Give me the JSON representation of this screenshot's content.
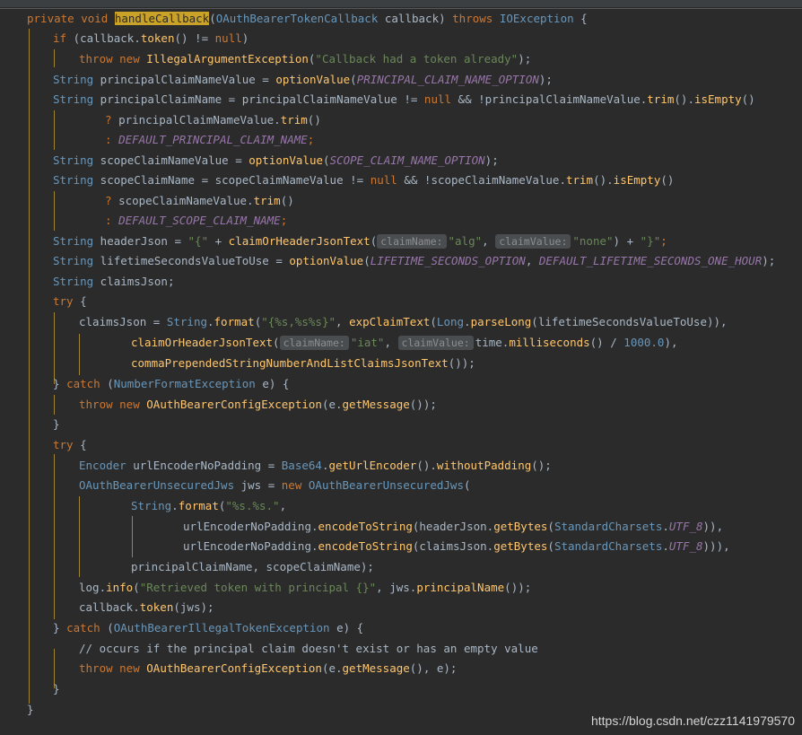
{
  "colors": {
    "background": "#2b2b2b",
    "keyword": "#cc7832",
    "type": "#6897bb",
    "method": "#ffc66d",
    "string": "#6a8759",
    "constant": "#9876aa",
    "plain": "#a9b7c6",
    "guide": "#c8a33a"
  },
  "code": {
    "l1": {
      "a": "private void ",
      "b": "handleCallback",
      "c": "(",
      "d": "OAuthBearerTokenCallback",
      "e": " callback) ",
      "f": "throws ",
      "g": "IOException",
      "h": " {"
    },
    "l2": {
      "a": "if ",
      "b": "(callback.",
      "c": "token",
      "d": "() != ",
      "e": "null",
      "f": ")"
    },
    "l3": {
      "a": "throw new ",
      "b": "IllegalArgumentException",
      "c": "(",
      "d": "\"Callback had a token already\"",
      "e": ");"
    },
    "l4": {
      "a": "String",
      "b": " principalClaimNameValue = ",
      "c": "optionValue",
      "d": "(",
      "e": "PRINCIPAL_CLAIM_NAME_OPTION",
      "f": ");"
    },
    "l5": {
      "a": "String",
      "b": " principalClaimName = principalClaimNameValue != ",
      "c": "null",
      "d": " && !principalClaimNameValue.",
      "e": "trim",
      "f": "().",
      "g": "isEmpty",
      "h": "()"
    },
    "l6": {
      "a": "? ",
      "b": "principalClaimNameValue.",
      "c": "trim",
      "d": "()"
    },
    "l7": {
      "a": ": ",
      "b": "DEFAULT_PRINCIPAL_CLAIM_NAME",
      "c": ";"
    },
    "l8": {
      "a": "String",
      "b": " scopeClaimNameValue = ",
      "c": "optionValue",
      "d": "(",
      "e": "SCOPE_CLAIM_NAME_OPTION",
      "f": ");"
    },
    "l9": {
      "a": "String",
      "b": " scopeClaimName = scopeClaimNameValue != ",
      "c": "null",
      "d": " && !scopeClaimNameValue.",
      "e": "trim",
      "f": "().",
      "g": "isEmpty",
      "h": "()"
    },
    "l10": {
      "a": "? ",
      "b": "scopeClaimNameValue.",
      "c": "trim",
      "d": "()"
    },
    "l11": {
      "a": ": ",
      "b": "DEFAULT_SCOPE_CLAIM_NAME",
      "c": ";"
    },
    "l12": {
      "a": "String",
      "b": " headerJson = ",
      "c": "\"{\"",
      "d": " + ",
      "e": "claimOrHeaderJsonText",
      "f": "(",
      "g": "claimName:",
      "h": "\"alg\"",
      "i": ", ",
      "j": "claimValue:",
      "k": "\"none\"",
      "l": ") + ",
      "m": "\"}\"",
      "n": ";"
    },
    "l13": {
      "a": "String",
      "b": " lifetimeSecondsValueToUse = ",
      "c": "optionValue",
      "d": "(",
      "e": "LIFETIME_SECONDS_OPTION",
      "f": ", ",
      "g": "DEFAULT_LIFETIME_SECONDS_ONE_HOUR",
      "h": ");"
    },
    "l14": {
      "a": "String",
      "b": " claimsJson;"
    },
    "l15": {
      "a": "try",
      "b": " {"
    },
    "l16": {
      "a": "claimsJson = ",
      "b": "String",
      "c": ".",
      "d": "format",
      "e": "(",
      "f": "\"{%s,%s%s}\"",
      "g": ", ",
      "h": "expClaimText",
      "i": "(",
      "j": "Long",
      "k": ".",
      "l": "parseLong",
      "m": "(lifetimeSecondsValueToUse)),"
    },
    "l17": {
      "a": "claimOrHeaderJsonText",
      "b": "(",
      "c": "claimName:",
      "d": "\"iat\"",
      "e": ", ",
      "f": "claimValue:",
      "g": "time.",
      "h": "milliseconds",
      "i": "() / ",
      "j": "1000.0",
      "k": "),"
    },
    "l18": {
      "a": "commaPrependedStringNumberAndListClaimsJsonText",
      "b": "());"
    },
    "l19": {
      "a": "} ",
      "b": "catch ",
      "c": "(",
      "d": "NumberFormatException",
      "e": " e) {"
    },
    "l20": {
      "a": "throw new ",
      "b": "OAuthBearerConfigException",
      "c": "(e.",
      "d": "getMessage",
      "e": "());"
    },
    "l21": {
      "a": "}"
    },
    "l22": {
      "a": "try",
      "b": " {"
    },
    "l23": {
      "a": "Encoder",
      "b": " urlEncoderNoPadding = ",
      "c": "Base64",
      "d": ".",
      "e": "getUrlEncoder",
      "f": "().",
      "g": "withoutPadding",
      "h": "();"
    },
    "l24": {
      "a": "OAuthBearerUnsecuredJws",
      "b": " jws = ",
      "c": "new ",
      "d": "OAuthBearerUnsecuredJws",
      "e": "("
    },
    "l25": {
      "a": "String",
      "b": ".",
      "c": "format",
      "d": "(",
      "e": "\"%s.%s.\"",
      "f": ","
    },
    "l26": {
      "a": "urlEncoderNoPadding.",
      "b": "encodeToString",
      "c": "(headerJson.",
      "d": "getBytes",
      "e": "(",
      "f": "StandardCharsets",
      "g": ".",
      "h": "UTF_8",
      "i": ")),"
    },
    "l27": {
      "a": "urlEncoderNoPadding.",
      "b": "encodeToString",
      "c": "(claimsJson.",
      "d": "getBytes",
      "e": "(",
      "f": "StandardCharsets",
      "g": ".",
      "h": "UTF_8",
      "i": "))),"
    },
    "l28": {
      "a": "principalClaimName, scopeClaimName);"
    },
    "l29": {
      "a": "log.",
      "b": "info",
      "c": "(",
      "d": "\"Retrieved token with principal {}\"",
      "e": ", ",
      "f": "jws.",
      "g": "principalName",
      "h": "());"
    },
    "l30": {
      "a": "callback.",
      "b": "token",
      "c": "(jws);"
    },
    "l31": {
      "a": "} ",
      "b": "catch ",
      "c": "(",
      "d": "OAuthBearerIllegalTokenException",
      "e": " e) {"
    },
    "l32": {
      "a": "// occurs if the principal claim doesn't exist or has an empty value"
    },
    "l33": {
      "a": "throw new ",
      "b": "OAuthBearerConfigException",
      "c": "(e.",
      "d": "getMessage",
      "e": "(), e);"
    },
    "l34": {
      "a": "}"
    },
    "l35": {
      "a": "}"
    }
  },
  "watermark": "https://blog.csdn.net/czz1141979570"
}
